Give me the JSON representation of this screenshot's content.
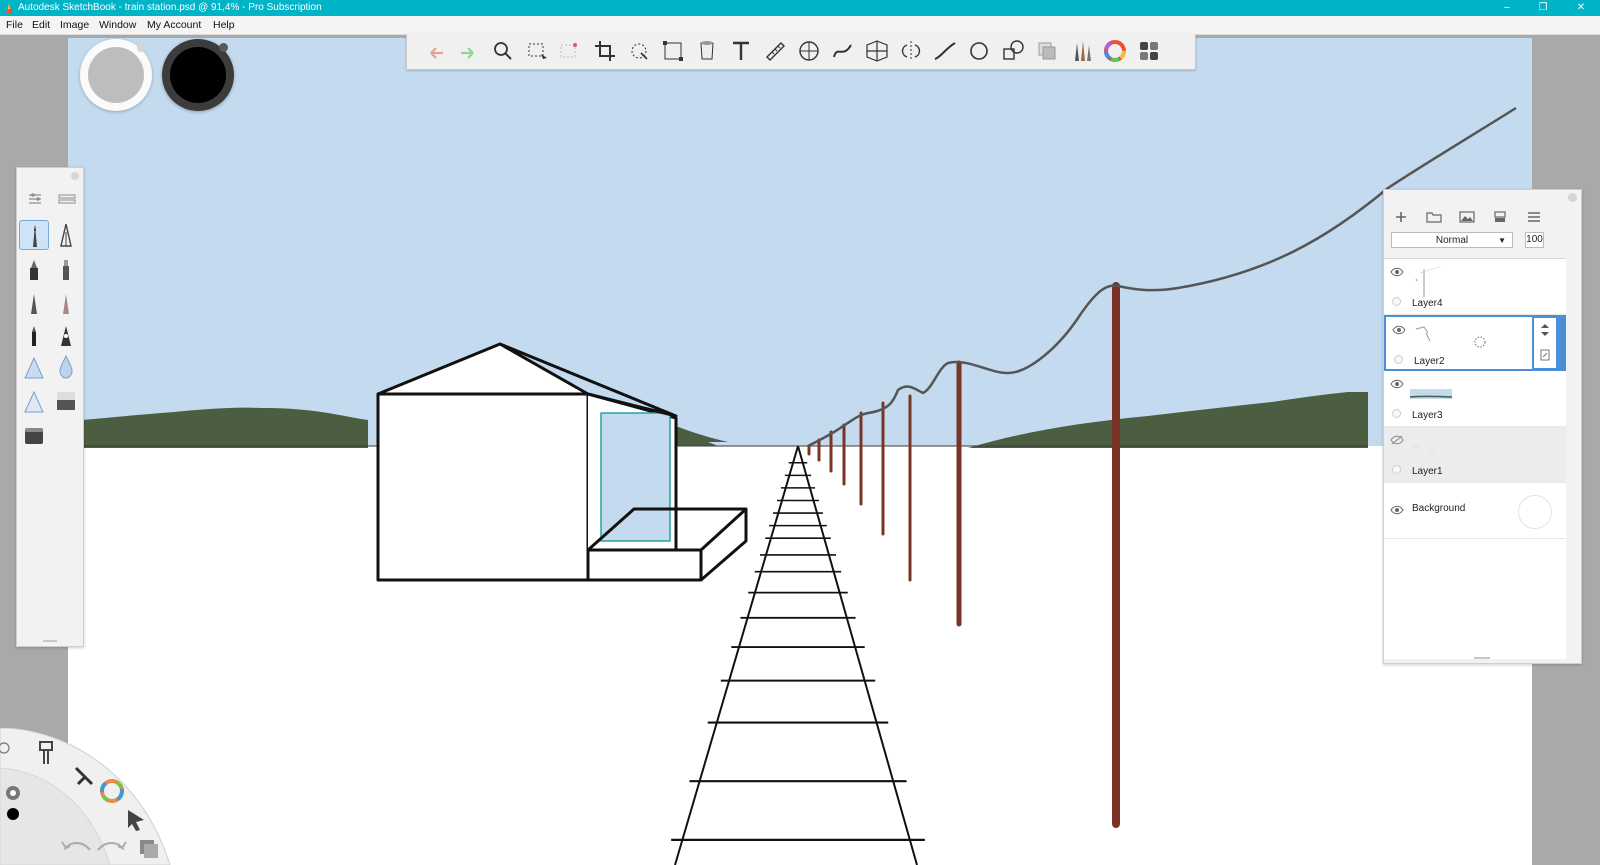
{
  "window": {
    "title": "Autodesk SketchBook - train station.psd @ 91,4% - Pro Subscription",
    "controls": {
      "minimize": "–",
      "maximize": "❐",
      "close": "✕"
    }
  },
  "menubar": {
    "items": [
      "File",
      "Edit",
      "Image",
      "Window",
      "My Account",
      "Help"
    ]
  },
  "toolbar": {
    "tools": [
      "undo-icon",
      "redo-icon",
      "zoom-icon",
      "select-icon",
      "lasso-select-icon",
      "crop-icon",
      "transform-icon",
      "distort-icon",
      "fill-icon",
      "text-icon",
      "ruler-icon",
      "ellipse-guide-icon",
      "french-curve-icon",
      "perspective-icon",
      "symmetry-icon",
      "stroke-icon",
      "ellipse-icon",
      "shape-icon",
      "copy-icon",
      "brushes-icon",
      "color-wheel-icon",
      "palette-icon"
    ]
  },
  "colors": {
    "sky": "#c4dbef",
    "hills": "#4c5e42",
    "ground": "#ffffff",
    "poles": "#7a3324",
    "wire": "#555555",
    "puck_primary": "#bdbdbd",
    "puck_secondary": "#000000",
    "accent": "#4a90d9",
    "titlebar": "#00b4c8"
  },
  "brush_palette": {
    "header_icons": [
      "brush-properties-icon",
      "brush-library-icon"
    ],
    "brushes": [
      "pencil-brush-icon",
      "ink-pen-brush-icon",
      "marker-brush-icon",
      "felt-tip-brush-icon",
      "hard-pencil-brush-icon",
      "airbrush-icon",
      "ballpoint-brush-icon",
      "calligraphy-brush-icon",
      "soft-eraser-brush-icon",
      "water-drop-brush-icon",
      "hard-eraser-brush-icon",
      "gradient-brush-icon",
      "smudge-brush-icon"
    ]
  },
  "layer_editor": {
    "blend_mode": "Normal",
    "opacity": "100",
    "layers": [
      {
        "name": "Layer4",
        "visible": true,
        "selected": false
      },
      {
        "name": "Layer2",
        "visible": true,
        "selected": true
      },
      {
        "name": "Layer3",
        "visible": true,
        "selected": false
      },
      {
        "name": "Layer1",
        "visible": false,
        "selected": false
      }
    ],
    "background_label": "Background"
  }
}
